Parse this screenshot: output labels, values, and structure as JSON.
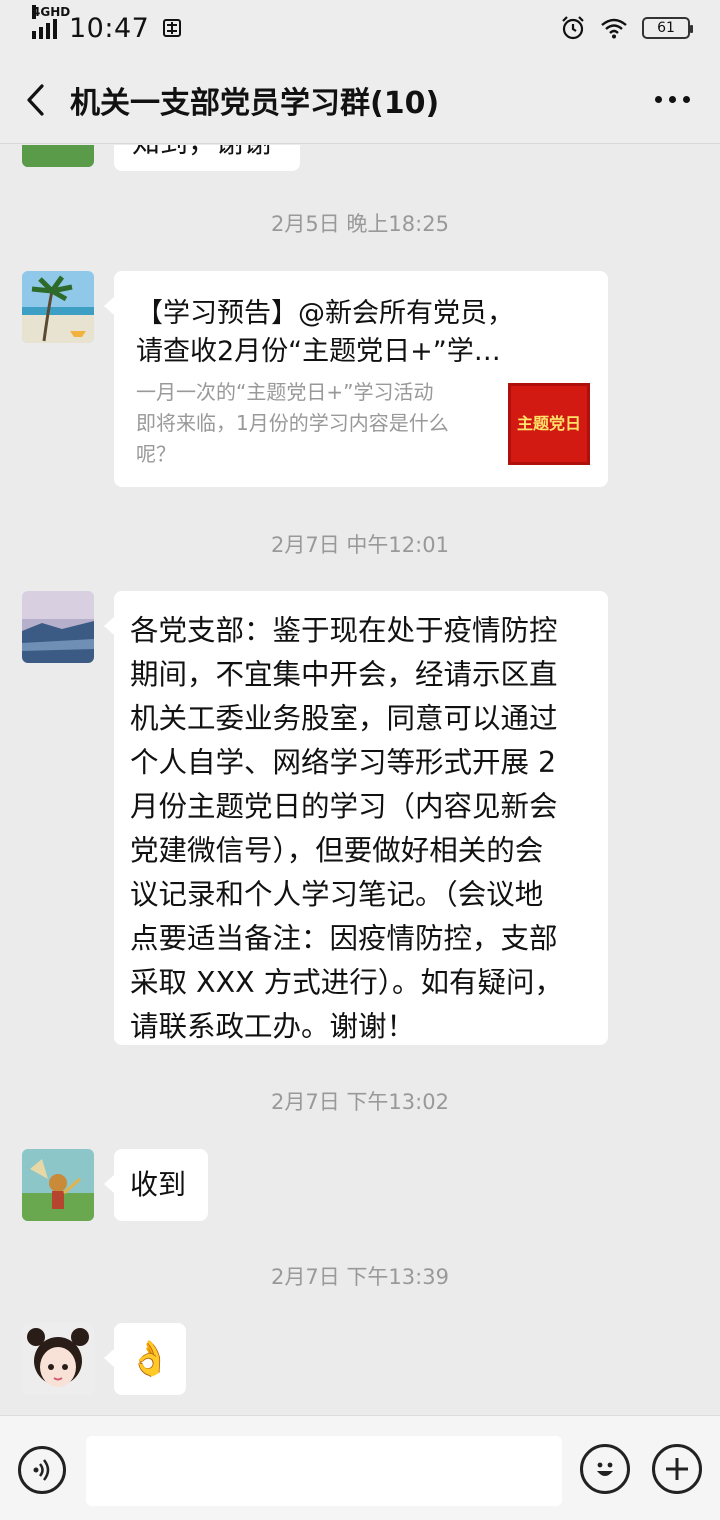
{
  "status_bar": {
    "network": "4GHD",
    "time": "10:47",
    "battery": "61"
  },
  "header": {
    "title": "机关一支部党员学习群(10)"
  },
  "messages": {
    "top_partial_text": "知到，谢谢",
    "ts1": "2月5日 晚上18:25",
    "card": {
      "title_line1": "【学习预告】@新会所有党员，",
      "title_line2": "请查收2月份“主题党日+”学…",
      "desc_line1": "一月一次的“主题党日+”学习活动",
      "desc_line2": "即将来临，1月份的学习内容是什么",
      "desc_line3": "呢？",
      "thumb_text": "主题党日"
    },
    "ts2": "2月7日 中午12:01",
    "notice_lines": [
      "各党支部：鉴于现在处于疫情防控",
      "期间，不宜集中开会，经请示区直",
      "机关工委业务股室，同意可以通过",
      "个人自学、网络学习等形式开展 2",
      "月份主题党日的学习（内容见新会",
      "党建微信号），但要做好相关的会",
      "议记录和个人学习笔记。（会议地",
      "点要适当备注：因疫情防控，支部",
      "采取 XXX 方式进行）。如有疑问，",
      "请联系政工办。谢谢！"
    ],
    "ts3": "2月7日 下午13:02",
    "received": "收到",
    "ts4": "2月7日 下午13:39",
    "ok_emoji": "👌"
  },
  "colors": {
    "background": "#ebebeb",
    "bubble": "#ffffff",
    "timestamp": "#999999",
    "card_thumb": "#d21a12"
  }
}
